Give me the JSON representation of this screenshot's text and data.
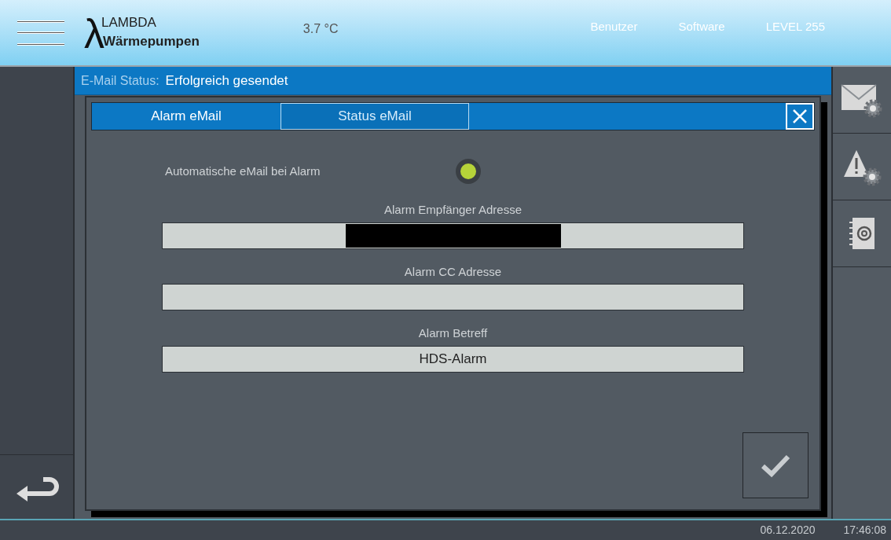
{
  "header": {
    "brand_symbol": "λ",
    "brand_top": "LAMBDA",
    "brand_bottom": "Wärmepumpen",
    "temperature": "3.7 °C",
    "links": [
      "Benutzer",
      "Software"
    ],
    "level": "LEVEL 255"
  },
  "email_status": {
    "label": "E-Mail Status:",
    "value": "Erfolgreich gesendet"
  },
  "dialog": {
    "tabs": [
      {
        "label": "Alarm eMail",
        "selected": true
      },
      {
        "label": "Status eMail",
        "selected": false
      }
    ],
    "toggle": {
      "label": "Automatische eMail bei Alarm",
      "on": true
    },
    "fields": [
      {
        "label": "Alarm Empfänger Adresse",
        "redacted": true
      },
      {
        "label": "Alarm CC Adresse",
        "redacted": false
      },
      {
        "label": "Alarm Betreff",
        "value": "HDS-Alarm",
        "redacted": false
      }
    ]
  },
  "status_bar": {
    "date": "06.12.2020",
    "time": "17:46:08"
  }
}
